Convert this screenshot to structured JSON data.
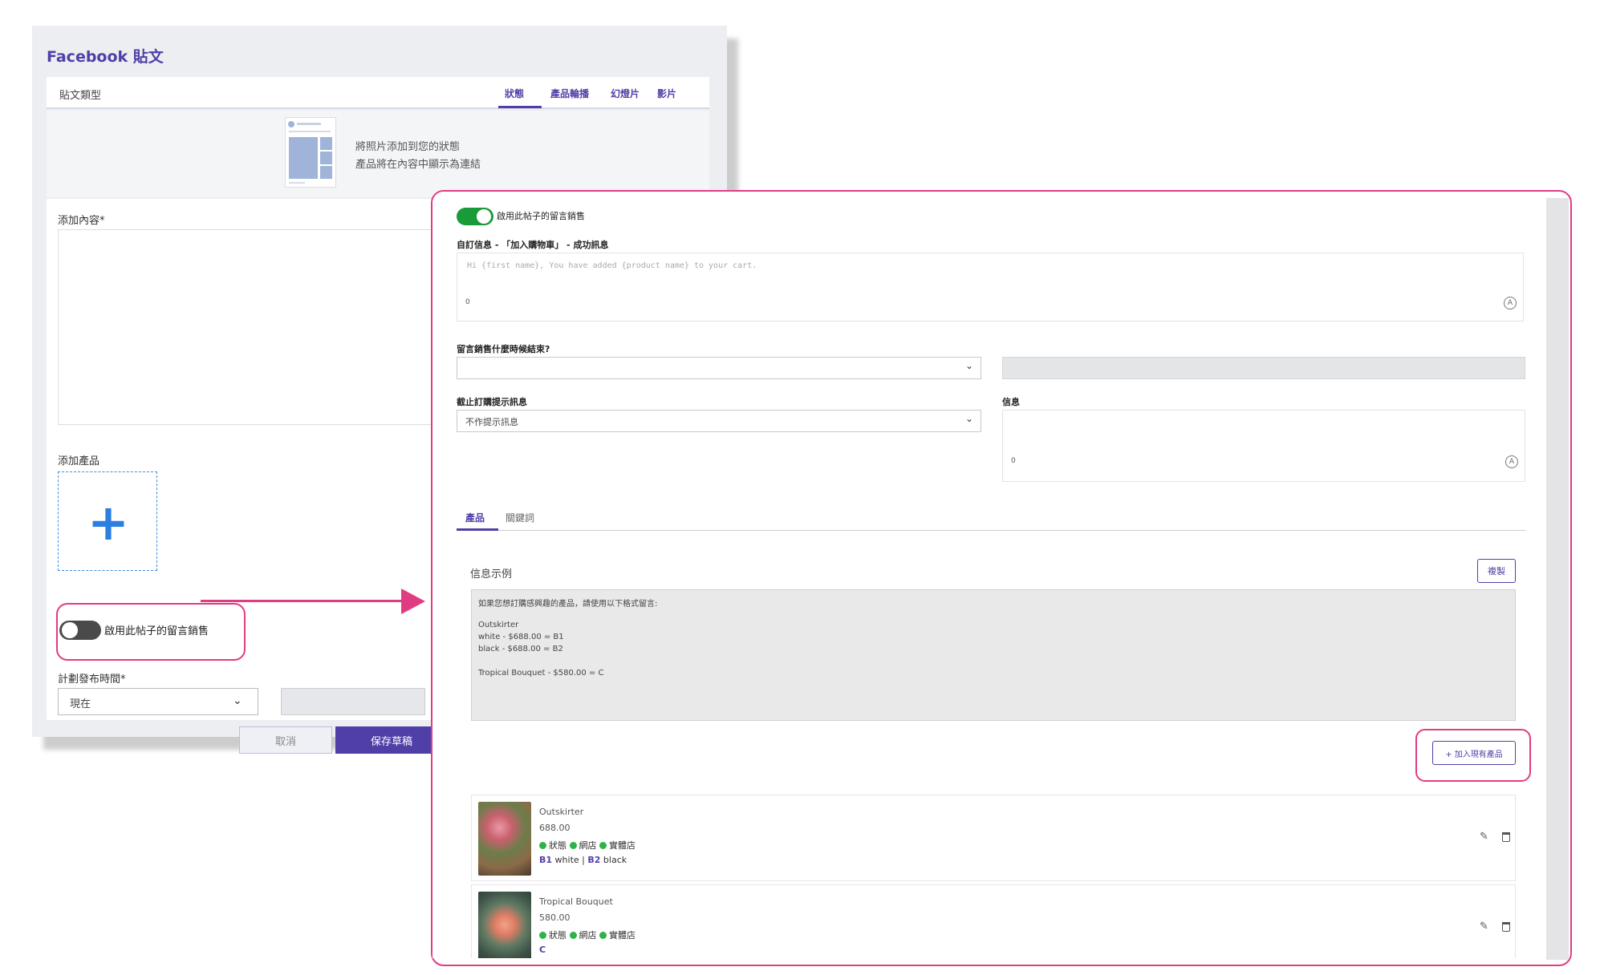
{
  "colors": {
    "brand": "#4f3fa7",
    "highlight": "#e03c82",
    "toggle_on": "#1a9b3a",
    "status_dot": "#2db34a"
  },
  "background_window": {
    "title": "Facebook 貼文",
    "post_type_label": "貼文類型",
    "post_type_tabs": [
      "狀態",
      "產品輪播",
      "幻燈片",
      "影片"
    ],
    "active_tab": "狀態",
    "preview_lines": [
      "將照片添加到您的狀態",
      "產品將在內容中顯示為連結"
    ],
    "content_label": "添加內容*",
    "product_label": "添加產品",
    "add_product_icon": "plus-icon",
    "comment_selling_toggle": {
      "label": "啟用此帖子的留言銷售",
      "on": false
    },
    "schedule_label": "計劃發布時間*",
    "schedule_value": "現在",
    "cancel_label": "取消",
    "save_draft_label": "保存草稿"
  },
  "foreground_panel": {
    "comment_selling_toggle": {
      "label": "啟用此帖子的留言銷售",
      "on": true
    },
    "custom_message_label": "自訂信息 - 「加入購物車」 - 成功訊息",
    "custom_message_placeholder": "Hi {first name}, You have added {product name} to your cart.",
    "custom_message_count": "0",
    "end_time_label": "留言銷售什麼時候結束?",
    "end_time_value": "",
    "cutoff_label": "截止訂購提示訊息",
    "cutoff_value": "不作提示訊息",
    "info_label": "信息",
    "info_count": "0",
    "tabs": [
      "產品",
      "關鍵詞"
    ],
    "active_tab": "產品",
    "example_title": "信息示例",
    "copy_label": "複製",
    "example_lines": [
      "如果您想訂購感興趣的產品，請使用以下格式留言:",
      "Outskirter",
      "white - $688.00 = B1",
      "black - $688.00 = B2",
      "Tropical Bouquet - $580.00 = C"
    ],
    "add_existing_label": "+ 加入現有產品",
    "products": [
      {
        "name": "Outskirter",
        "price": "688.00",
        "statuses": [
          "狀態",
          "網店",
          "實體店"
        ],
        "code1": "B1",
        "variant1": "white",
        "sep": "|",
        "code2": "B2",
        "variant2": "black"
      },
      {
        "name": "Tropical Bouquet",
        "price": "580.00",
        "statuses": [
          "狀態",
          "網店",
          "實體店"
        ],
        "code1": "C"
      }
    ]
  }
}
